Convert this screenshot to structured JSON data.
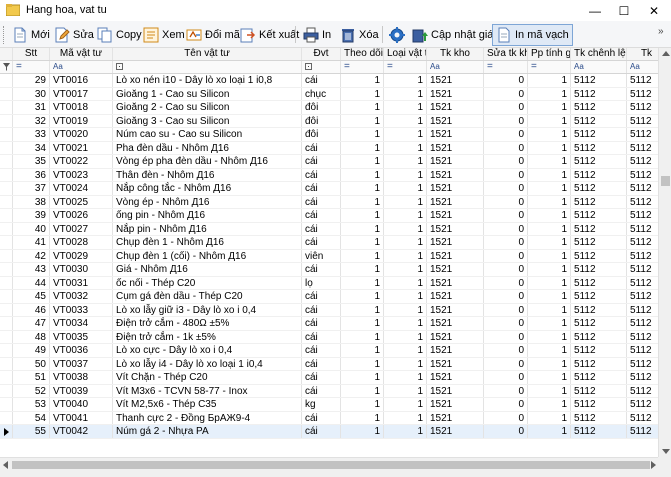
{
  "window": {
    "title": "Hang hoa, vat tu",
    "minimize": "—",
    "maximize": "☐",
    "close": "✕"
  },
  "toolbar": {
    "new": "Mới",
    "edit": "Sửa",
    "copy": "Copy",
    "view": "Xem",
    "rename_code": "Đổi mã",
    "export": "Kết xuất",
    "print": "In",
    "delete": "Xóa",
    "update_value": "Cập nhật giá trị",
    "print_barcode": "In mã vạch",
    "more": "»"
  },
  "grid": {
    "columns": [
      "Stt",
      "Mã vật tư",
      "Tên vật tư",
      "Đvt",
      "Theo dõi",
      "Loại vật t",
      "Tk kho",
      "Sửa tk kh",
      "Pp tính gi",
      "Tk chênh lệch",
      "Tk"
    ],
    "filter_text": "Aa",
    "filter_eq": "=",
    "rows": [
      {
        "stt": "29",
        "code": "VT0016",
        "name": "Lò xo nén i10 - Dây lò xo loại 1 i0,8",
        "unit": "cái",
        "track": "1",
        "type": "1",
        "acc": "1521",
        "edit": "0",
        "method": "1",
        "diff": "5112"
      },
      {
        "stt": "30",
        "code": "VT0017",
        "name": "Gioăng 1 - Cao su Silicon",
        "unit": "chục",
        "track": "1",
        "type": "1",
        "acc": "1521",
        "edit": "0",
        "method": "1",
        "diff": "5112"
      },
      {
        "stt": "31",
        "code": "VT0018",
        "name": "Gioăng 2 - Cao su Silicon",
        "unit": "đôi",
        "track": "1",
        "type": "1",
        "acc": "1521",
        "edit": "0",
        "method": "1",
        "diff": "5112"
      },
      {
        "stt": "32",
        "code": "VT0019",
        "name": "Gioăng 3 - Cao su Silicon",
        "unit": "đôi",
        "track": "1",
        "type": "1",
        "acc": "1521",
        "edit": "0",
        "method": "1",
        "diff": "5112"
      },
      {
        "stt": "33",
        "code": "VT0020",
        "name": "Núm cao su - Cao su Silicon",
        "unit": "đôi",
        "track": "1",
        "type": "1",
        "acc": "1521",
        "edit": "0",
        "method": "1",
        "diff": "5112"
      },
      {
        "stt": "34",
        "code": "VT0021",
        "name": "Pha đèn dầu - Nhôm Д16",
        "unit": "cái",
        "track": "1",
        "type": "1",
        "acc": "1521",
        "edit": "0",
        "method": "1",
        "diff": "5112"
      },
      {
        "stt": "35",
        "code": "VT0022",
        "name": "Vòng ép pha đèn dầu - Nhôm Д16",
        "unit": "cái",
        "track": "1",
        "type": "1",
        "acc": "1521",
        "edit": "0",
        "method": "1",
        "diff": "5112"
      },
      {
        "stt": "36",
        "code": "VT0023",
        "name": "Thân đèn - Nhôm Д16",
        "unit": "cái",
        "track": "1",
        "type": "1",
        "acc": "1521",
        "edit": "0",
        "method": "1",
        "diff": "5112"
      },
      {
        "stt": "37",
        "code": "VT0024",
        "name": "Nắp công tắc - Nhôm Д16",
        "unit": "cái",
        "track": "1",
        "type": "1",
        "acc": "1521",
        "edit": "0",
        "method": "1",
        "diff": "5112"
      },
      {
        "stt": "38",
        "code": "VT0025",
        "name": "Vòng ép - Nhôm Д16",
        "unit": "cái",
        "track": "1",
        "type": "1",
        "acc": "1521",
        "edit": "0",
        "method": "1",
        "diff": "5112"
      },
      {
        "stt": "39",
        "code": "VT0026",
        "name": "ống pin - Nhôm Д16",
        "unit": "cái",
        "track": "1",
        "type": "1",
        "acc": "1521",
        "edit": "0",
        "method": "1",
        "diff": "5112"
      },
      {
        "stt": "40",
        "code": "VT0027",
        "name": "Nắp pin - Nhôm Д16",
        "unit": "cái",
        "track": "1",
        "type": "1",
        "acc": "1521",
        "edit": "0",
        "method": "1",
        "diff": "5112"
      },
      {
        "stt": "41",
        "code": "VT0028",
        "name": "Chụp đèn 1 - Nhôm Д16",
        "unit": "cái",
        "track": "1",
        "type": "1",
        "acc": "1521",
        "edit": "0",
        "method": "1",
        "diff": "5112"
      },
      {
        "stt": "42",
        "code": "VT0029",
        "name": "Chụp đèn 1 (cối) - Nhôm Д16",
        "unit": "viên",
        "track": "1",
        "type": "1",
        "acc": "1521",
        "edit": "0",
        "method": "1",
        "diff": "5112"
      },
      {
        "stt": "43",
        "code": "VT0030",
        "name": "Giá - Nhôm Д16",
        "unit": "cái",
        "track": "1",
        "type": "1",
        "acc": "1521",
        "edit": "0",
        "method": "1",
        "diff": "5112"
      },
      {
        "stt": "44",
        "code": "VT0031",
        "name": "ốc nối - Thép C20",
        "unit": "lọ",
        "track": "1",
        "type": "1",
        "acc": "1521",
        "edit": "0",
        "method": "1",
        "diff": "5112"
      },
      {
        "stt": "45",
        "code": "VT0032",
        "name": "Cụm gá đèn dầu - Thép C20",
        "unit": "cái",
        "track": "1",
        "type": "1",
        "acc": "1521",
        "edit": "0",
        "method": "1",
        "diff": "5112"
      },
      {
        "stt": "46",
        "code": "VT0033",
        "name": "Lò xo lẫy giữ i3 - Dây lò xo i 0,4",
        "unit": "cái",
        "track": "1",
        "type": "1",
        "acc": "1521",
        "edit": "0",
        "method": "1",
        "diff": "5112"
      },
      {
        "stt": "47",
        "code": "VT0034",
        "name": "Điện trở cắm - 480Ω ±5%",
        "unit": "cái",
        "track": "1",
        "type": "1",
        "acc": "1521",
        "edit": "0",
        "method": "1",
        "diff": "5112"
      },
      {
        "stt": "48",
        "code": "VT0035",
        "name": "Điện trở cắm - 1k ±5%",
        "unit": "cái",
        "track": "1",
        "type": "1",
        "acc": "1521",
        "edit": "0",
        "method": "1",
        "diff": "5112"
      },
      {
        "stt": "49",
        "code": "VT0036",
        "name": "Lò xo cực - Dây lò xo i 0,4",
        "unit": "cái",
        "track": "1",
        "type": "1",
        "acc": "1521",
        "edit": "0",
        "method": "1",
        "diff": "5112"
      },
      {
        "stt": "50",
        "code": "VT0037",
        "name": "Lò xo lẫy i4 - Dây lò xo loại 1 i0,4",
        "unit": "cái",
        "track": "1",
        "type": "1",
        "acc": "1521",
        "edit": "0",
        "method": "1",
        "diff": "5112"
      },
      {
        "stt": "51",
        "code": "VT0038",
        "name": "Vít Chặn - Thép C20",
        "unit": "cái",
        "track": "1",
        "type": "1",
        "acc": "1521",
        "edit": "0",
        "method": "1",
        "diff": "5112"
      },
      {
        "stt": "52",
        "code": "VT0039",
        "name": "Vít M3x6 - TCVN 58-77 - Inox",
        "unit": "cái",
        "track": "1",
        "type": "1",
        "acc": "1521",
        "edit": "0",
        "method": "1",
        "diff": "5112"
      },
      {
        "stt": "53",
        "code": "VT0040",
        "name": "Vít M2,5x6 - Thép C35",
        "unit": "kg",
        "track": "1",
        "type": "1",
        "acc": "1521",
        "edit": "0",
        "method": "1",
        "diff": "5112"
      },
      {
        "stt": "54",
        "code": "VT0041",
        "name": "Thanh cực 2 - Đồng БрАЖ9-4",
        "unit": "cái",
        "track": "1",
        "type": "1",
        "acc": "1521",
        "edit": "0",
        "method": "1",
        "diff": "5112"
      },
      {
        "stt": "55",
        "code": "VT0042",
        "name": "Núm gá 2 - Nhựa PA",
        "unit": "cái",
        "track": "1",
        "type": "1",
        "acc": "1521",
        "edit": "0",
        "method": "1",
        "diff": "5112"
      }
    ]
  }
}
